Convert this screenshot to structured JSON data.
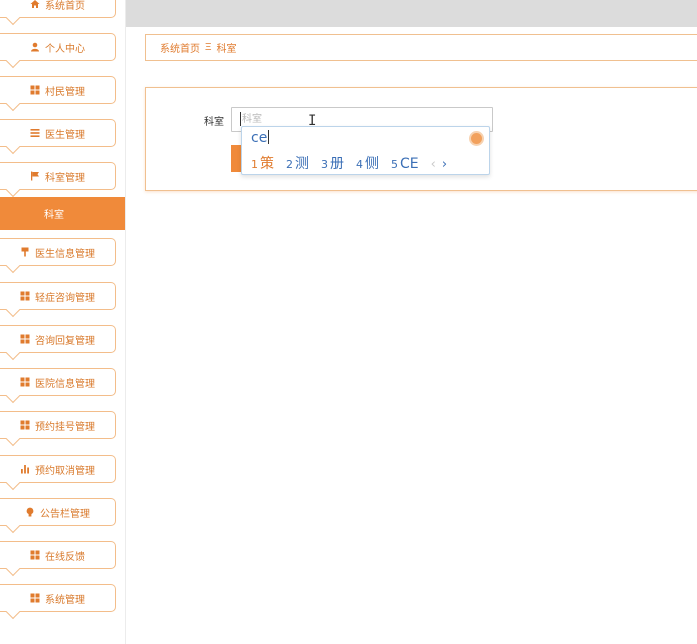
{
  "sidebar": {
    "items": [
      {
        "label": "系统首页",
        "icon": "home-icon"
      },
      {
        "label": "个人中心",
        "icon": "user-icon"
      },
      {
        "label": "村民管理",
        "icon": "grid-icon"
      },
      {
        "label": "医生管理",
        "icon": "list-icon"
      },
      {
        "label": "科室管理",
        "icon": "flag-icon"
      },
      {
        "label": "医生信息管理",
        "icon": "pin-icon"
      },
      {
        "label": "轻症咨询管理",
        "icon": "grid-icon"
      },
      {
        "label": "咨询回复管理",
        "icon": "grid-icon"
      },
      {
        "label": "医院信息管理",
        "icon": "grid-icon"
      },
      {
        "label": "预约挂号管理",
        "icon": "grid-icon"
      },
      {
        "label": "预约取消管理",
        "icon": "bar-chart-icon"
      },
      {
        "label": "公告栏管理",
        "icon": "bulb-icon"
      },
      {
        "label": "在线反馈",
        "icon": "grid-icon"
      },
      {
        "label": "系统管理",
        "icon": "grid-icon"
      }
    ],
    "active_subitem": "科室"
  },
  "breadcrumb": {
    "home": "系统首页",
    "separator": "Ξ",
    "current": "科室"
  },
  "search": {
    "label": "科室",
    "placeholder": "科室"
  },
  "ime": {
    "composition": "ce",
    "candidates": [
      {
        "num": "1",
        "text": "策"
      },
      {
        "num": "2",
        "text": "测"
      },
      {
        "num": "3",
        "text": "册"
      },
      {
        "num": "4",
        "text": "侧"
      },
      {
        "num": "5",
        "text": "CE"
      }
    ],
    "prev": "‹",
    "next": "›"
  },
  "colors": {
    "accent": "#f08a3a",
    "border": "#f3bd8a",
    "topbar": "#dcdcdc"
  }
}
